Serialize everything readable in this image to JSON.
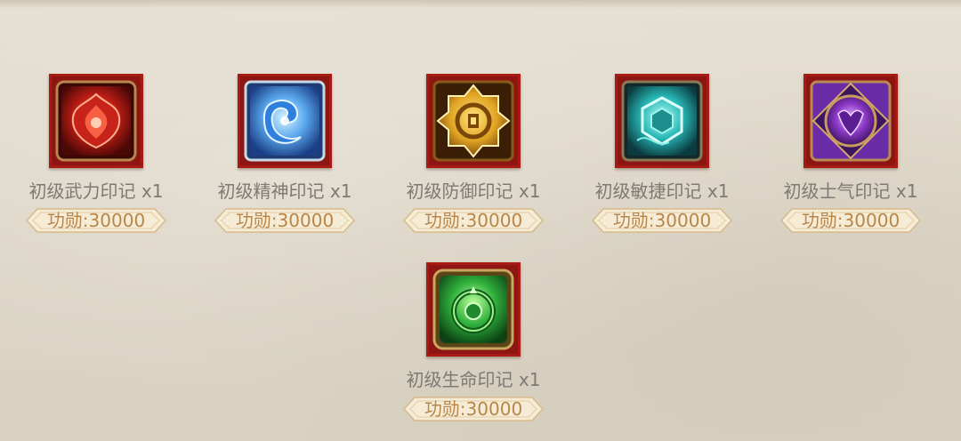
{
  "items": [
    {
      "name": "初级武力印记 x1",
      "price": "功勋:30000",
      "icon": "red-force-seal-icon",
      "color": "#c0231a"
    },
    {
      "name": "初级精神印记 x1",
      "price": "功勋:30000",
      "icon": "blue-spirit-seal-icon",
      "color": "#3d8fe0"
    },
    {
      "name": "初级防御印记 x1",
      "price": "功勋:30000",
      "icon": "gold-defense-seal-icon",
      "color": "#e0a323"
    },
    {
      "name": "初级敏捷印记 x1",
      "price": "功勋:30000",
      "icon": "cyan-agility-seal-icon",
      "color": "#27b8b5"
    },
    {
      "name": "初级士气印记 x1",
      "price": "功勋:30000",
      "icon": "purple-morale-seal-icon",
      "color": "#8b38c7"
    },
    {
      "name": "初级生命印记 x1",
      "price": "功勋:30000",
      "icon": "green-life-seal-icon",
      "color": "#2fae3b"
    }
  ]
}
